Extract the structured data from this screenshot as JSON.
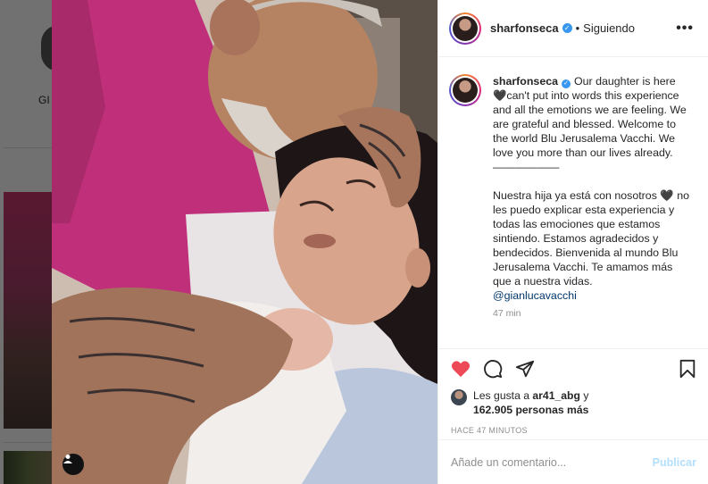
{
  "background": {
    "profile_name_partial": "GI"
  },
  "post": {
    "username": "sharfonseca",
    "follow_status": "Siguiendo",
    "separator": "•",
    "more_label": "•••",
    "caption_english": "Our daughter is here 🖤can't put into words this experience and all the emotions we are feeling. We are grateful and blessed. Welcome to the world Blu Jerusalema Vacchi. We love you more than our lives already.",
    "caption_divider": "——————",
    "caption_spanish": "Nuestra hija ya está con nosotros 🖤 no les puedo explicar esta experiencia y todas las emociones que estamos sintiendo. Estamos agradecidos y bendecidos. Bienvenida al mundo Blu Jerusalema Vacchi. Te amamos más que a nuestra vidas.",
    "mention": "@gianlucavacchi",
    "caption_time": "47 min",
    "likes_prefix": "Les gusta a ",
    "likes_user": "ar41_abg",
    "likes_conj": " y",
    "likes_count": "162.905 personas más",
    "time_ago": "HACE 47 MINUTOS",
    "comment_placeholder": "Añade un comentario...",
    "post_button": "Publicar",
    "liked": true
  },
  "icons": [
    "heart-icon",
    "comment-icon",
    "share-icon",
    "bookmark-icon",
    "more-options-icon",
    "user-tag-icon",
    "verified-icon"
  ],
  "colors": {
    "like_red": "#ed4956",
    "verified_blue": "#3897f0",
    "publish_disabled": "#b2dffc",
    "mention": "#00376b"
  }
}
